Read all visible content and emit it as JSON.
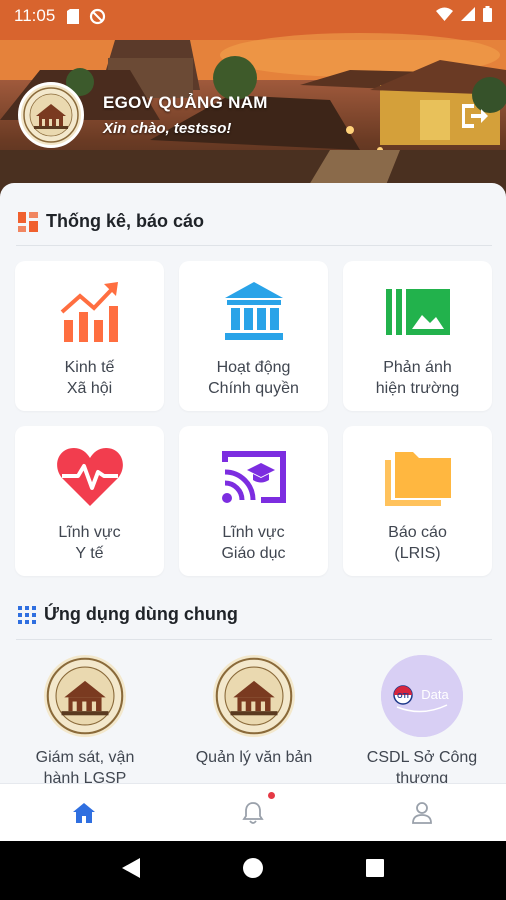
{
  "status_bar": {
    "time": "11:05",
    "icons": [
      "sim-icon",
      "data-saver-icon",
      "wifi-icon",
      "signal-icon",
      "battery-icon"
    ]
  },
  "header": {
    "title": "EGOV QUẢNG NAM",
    "greeting": "Xin chào, testsso!",
    "logout_icon": "logout-icon"
  },
  "stats_section": {
    "title": "Thống kê, báo cáo",
    "icon": "dashboard-icon",
    "cards": [
      {
        "label": "Kinh tế\nXã hội",
        "icon": "trending-chart-icon",
        "color": "#ff6e40"
      },
      {
        "label": "Hoạt động\nChính quyền",
        "icon": "government-building-icon",
        "color": "#29a3e8"
      },
      {
        "label": "Phản ánh\nhiện trường",
        "icon": "photo-gallery-icon",
        "color": "#22b24c"
      },
      {
        "label": "Lĩnh vực\nY tế",
        "icon": "heart-pulse-icon",
        "color": "#f23d4e"
      },
      {
        "label": "Lĩnh vực\nGiáo dục",
        "icon": "cast-education-icon",
        "color": "#7c2de0"
      },
      {
        "label": "Báo cáo\n(LRIS)",
        "icon": "folder-icon",
        "color": "#ffb740"
      }
    ]
  },
  "apps_section": {
    "title": "Ứng dụng dùng chung",
    "icon": "apps-grid-icon",
    "apps": [
      {
        "label": "Giám sát, vận\nhành LGSP",
        "icon": "quang-nam-seal-icon"
      },
      {
        "label": "Quản lý văn bản",
        "icon": "quang-nam-seal-icon"
      },
      {
        "label": "CSDL Sở Công\nthương",
        "icon": "data-logo-icon",
        "logo_text": "OTI",
        "logo_sub": "Data"
      }
    ]
  },
  "bottom_nav": {
    "items": [
      "home-icon",
      "notification-bell-icon",
      "user-profile-icon"
    ],
    "active": "home-icon",
    "active_color": "#2f6fe0"
  },
  "system_nav": [
    "back-icon",
    "home-circle-icon",
    "recents-icon"
  ]
}
